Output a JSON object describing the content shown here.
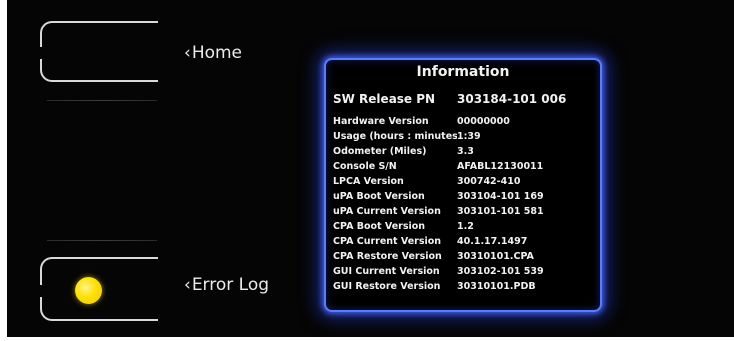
{
  "nav": {
    "home_label": "Home",
    "error_log_label": "Error Log",
    "chevron_glyph": "‹"
  },
  "indicator": {
    "color": "#ffe000"
  },
  "info": {
    "title": "Information",
    "primary": {
      "label": "SW Release PN",
      "value": "303184-101 006"
    },
    "rows": [
      {
        "label": "Hardware Version",
        "value": "00000000"
      },
      {
        "label": "Usage (hours : minutes)",
        "value": "1:39"
      },
      {
        "label": "Odometer (Miles)",
        "value": "3.3"
      },
      {
        "label": "Console S/N",
        "value": "AFABL12130011"
      },
      {
        "label": "LPCA Version",
        "value": "300742-410"
      },
      {
        "label": "uPA Boot Version",
        "value": "303104-101 169"
      },
      {
        "label": "uPA Current Version",
        "value": "303101-101 581"
      },
      {
        "label": "CPA Boot Version",
        "value": "1.2"
      },
      {
        "label": "CPA Current Version",
        "value": "40.1.17.1497"
      },
      {
        "label": "CPA Restore Version",
        "value": "30310101.CPA"
      },
      {
        "label": "GUI Current Version",
        "value": "303102-101 539"
      },
      {
        "label": "GUI Restore Version",
        "value": "30310101.PDB"
      }
    ]
  },
  "colors": {
    "panel_border": "#5a7cff",
    "background": "#050505",
    "text": "#f2f2f2"
  }
}
